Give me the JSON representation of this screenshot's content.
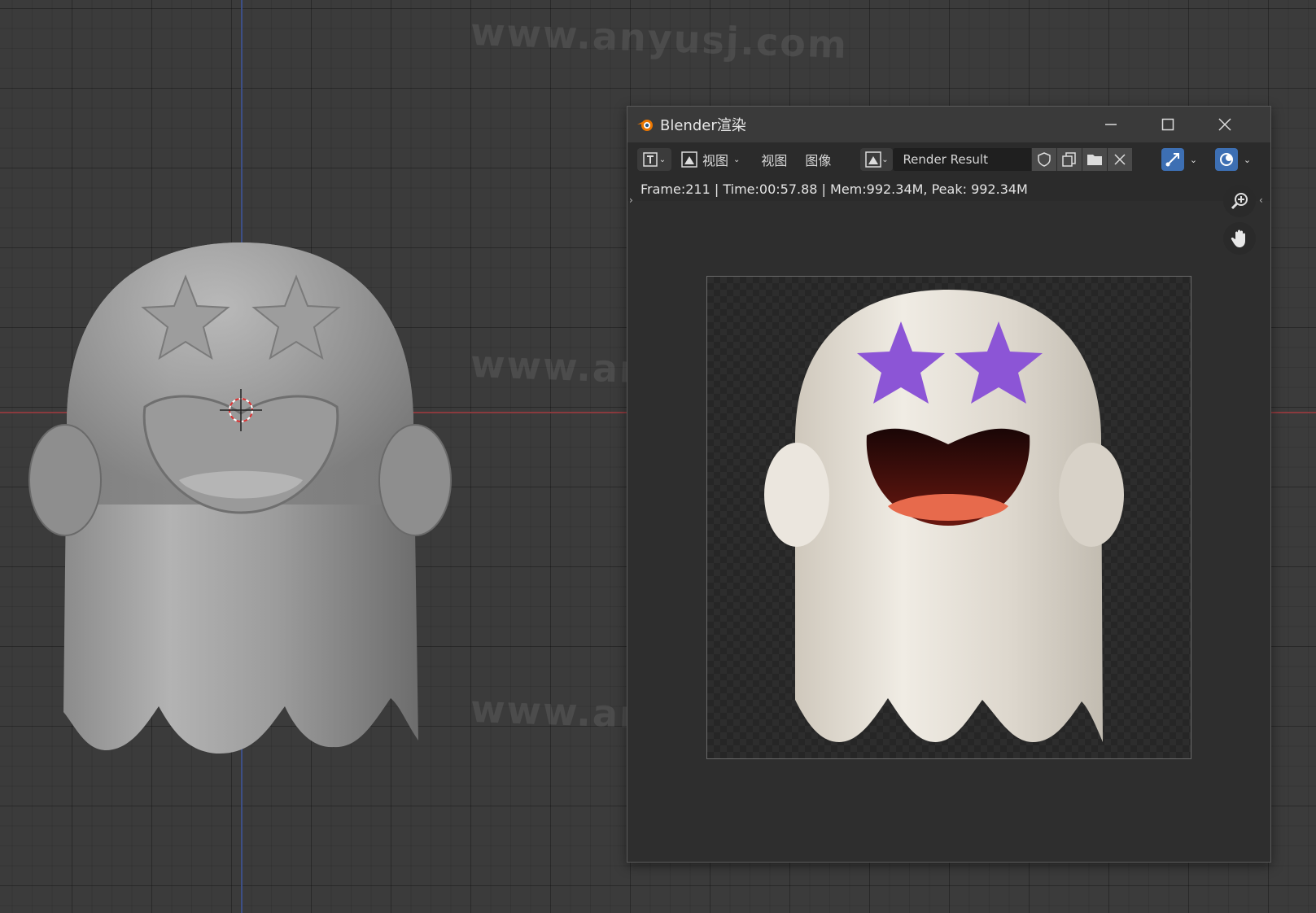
{
  "watermark": {
    "text": "www.anyusj.com"
  },
  "viewport": {
    "grid_color": "#3b3b3b",
    "x_axis_color": "#8a3a3e",
    "y_axis_color": "#3d4f86",
    "icons": [
      "3d-cursor-icon"
    ]
  },
  "render_window": {
    "title": "Blender渲染",
    "toolbar": {
      "view_label": "视图",
      "menu_view": "视图",
      "menu_image": "图像",
      "image_name": "Render Result"
    },
    "stats": "Frame:211 | Time:00:57.88 | Mem:992.34M, Peak: 992.34M",
    "accent_color": "#3d6fb3",
    "icons": [
      "blender-logo-icon",
      "minimize-icon",
      "maximize-icon",
      "close-icon",
      "editor-type-icon",
      "view-image-icon",
      "image-browse-icon",
      "fake-user-shield-icon",
      "new-image-icon",
      "open-folder-icon",
      "unlink-x-icon",
      "gizmo-icon",
      "overlay-icon",
      "zoom-icon",
      "hand-pan-icon"
    ]
  }
}
